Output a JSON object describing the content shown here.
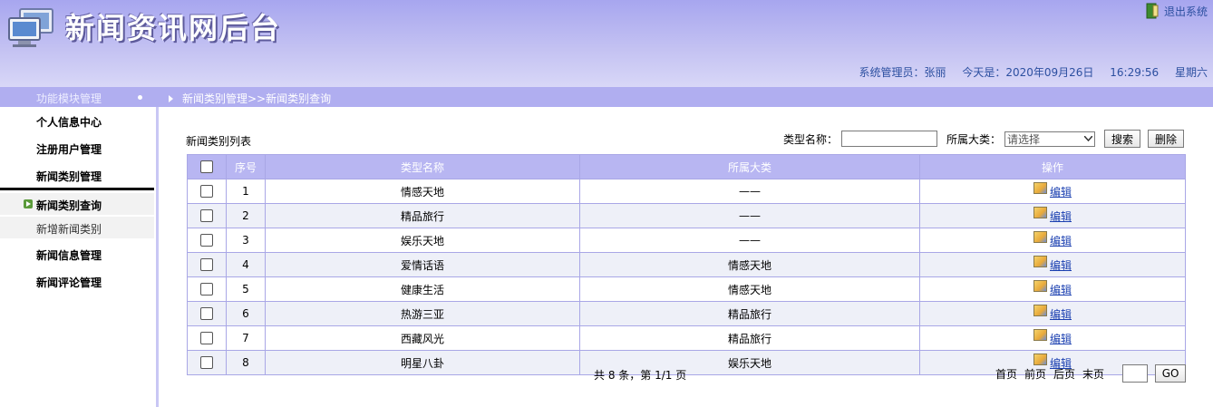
{
  "header": {
    "title": "新闻资讯网后台",
    "logout_label": "退出系统",
    "admin_label": "系统管理员：张丽",
    "date_label": "今天是：2020年09月26日",
    "time_label": "16:29:56",
    "weekday_label": "星期六"
  },
  "nav": {
    "module_title": "功能模块管理",
    "breadcrumb": "新闻类别管理>>新闻类别查询"
  },
  "sidebar": {
    "items": [
      {
        "label": "个人信息中心"
      },
      {
        "label": "注册用户管理"
      },
      {
        "label": "新闻类别管理"
      },
      {
        "label": "新闻信息管理"
      },
      {
        "label": "新闻评论管理"
      }
    ],
    "sub_items": [
      {
        "label": "新闻类别查询"
      },
      {
        "label": "新增新闻类别"
      }
    ]
  },
  "main": {
    "list_title": "新闻类别列表",
    "search": {
      "type_label": "类型名称：",
      "type_value": "",
      "category_label": "所属大类：",
      "category_selected": "请选择",
      "search_label": "搜索",
      "delete_label": "删除"
    },
    "table": {
      "headers": [
        "序号",
        "类型名称",
        "所属大类",
        "操作"
      ],
      "edit_label": "编辑",
      "rows": [
        {
          "no": "1",
          "name": "情感天地",
          "parent": "——"
        },
        {
          "no": "2",
          "name": "精品旅行",
          "parent": "——"
        },
        {
          "no": "3",
          "name": "娱乐天地",
          "parent": "——"
        },
        {
          "no": "4",
          "name": "爱情话语",
          "parent": "情感天地"
        },
        {
          "no": "5",
          "name": "健康生活",
          "parent": "情感天地"
        },
        {
          "no": "6",
          "name": "热游三亚",
          "parent": "精品旅行"
        },
        {
          "no": "7",
          "name": "西藏风光",
          "parent": "精品旅行"
        },
        {
          "no": "8",
          "name": "明星八卦",
          "parent": "娱乐天地"
        }
      ]
    },
    "footer": {
      "count_text": "共 8 条，第 1/1 页",
      "first_label": "首页",
      "prev_label": "前页",
      "next_label": "后页",
      "last_label": "末页",
      "page_value": "",
      "go_label": "GO"
    }
  },
  "colors": {
    "header_gradient_top": "#a7a6ef",
    "navbar": "#b0aef0",
    "table_header": "#b8b6f2",
    "link": "#1a3fb0"
  },
  "icons": [
    "computer-monitor-icon",
    "door-exit-icon",
    "bullet-arrow-icon",
    "edit-icon"
  ]
}
